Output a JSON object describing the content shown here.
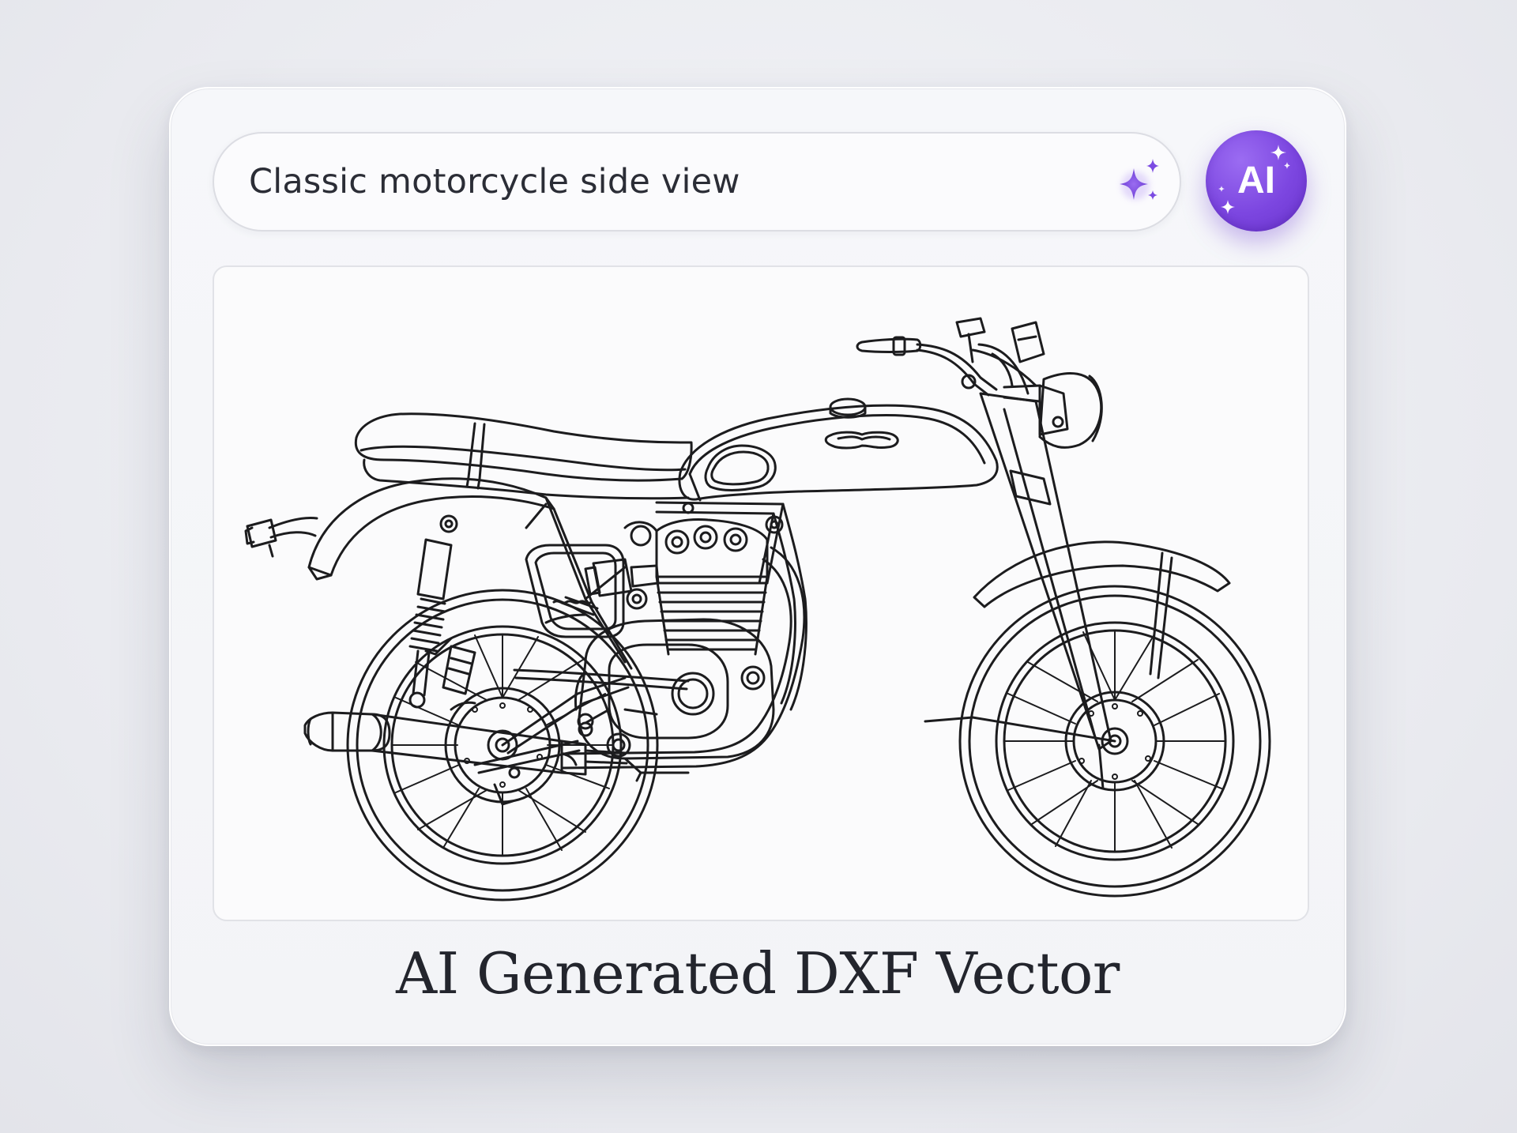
{
  "prompt": {
    "value": "Classic motorcycle side view"
  },
  "ai_button": {
    "label": "AI"
  },
  "icons": {
    "prompt_sparkle": "sparkles-icon",
    "ai_sparkle": "sparkles-icon"
  },
  "colors": {
    "accent": "#7c46e0",
    "accent_light": "#9b6cf2",
    "text": "#2b2d36",
    "line_art": "#1c1c1e"
  },
  "caption": "AI Generated DXF Vector"
}
